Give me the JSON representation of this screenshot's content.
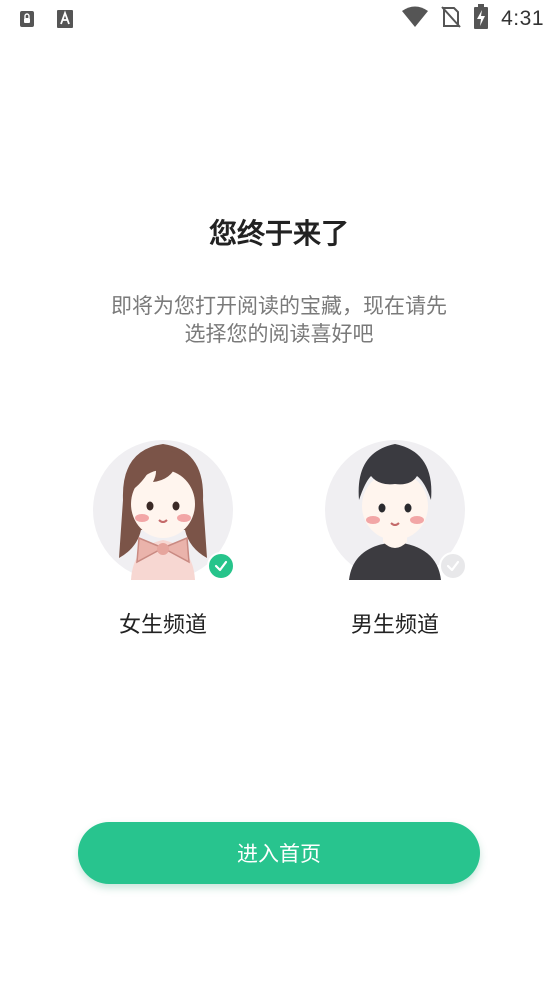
{
  "status_bar": {
    "time": "4:31",
    "left_icons": [
      "sim-lock-icon",
      "font-a-icon"
    ],
    "right_icons": [
      "wifi-icon",
      "no-sim-icon",
      "battery-charging-icon"
    ]
  },
  "welcome": {
    "title": "您终于来了",
    "subtitle_line1": "即将为您打开阅读的宝藏，现在请先",
    "subtitle_line2": "选择您的阅读喜好吧"
  },
  "channels": [
    {
      "label": "女生频道",
      "selected": true
    },
    {
      "label": "男生频道",
      "selected": false
    }
  ],
  "enter_button": {
    "label": "进入首页"
  },
  "colors": {
    "accent": "#28c48e",
    "check_selected": "#27c48b",
    "check_unselected": "#e8e8ea",
    "subtitle_text": "#7a7a7a"
  }
}
